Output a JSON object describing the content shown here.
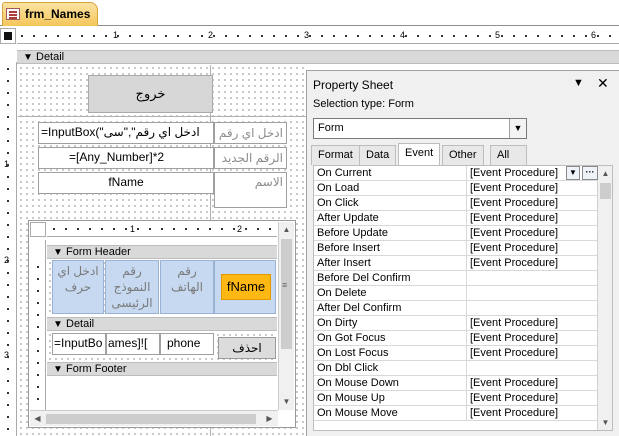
{
  "document_tab": {
    "label": "frm_Names",
    "icon": "form-icon"
  },
  "ruler": {
    "top_numbers": [
      "1",
      "2",
      "3",
      "4",
      "5",
      "6"
    ],
    "left_numbers": [
      "1",
      "2",
      "3"
    ]
  },
  "sections": {
    "detail": "Detail"
  },
  "main_form": {
    "exit_button": "خروج",
    "row1_text": "=InputBox(\"ادخل اي رقم\",\"سى",
    "row1_label": "ادخل اي رقم",
    "row2_text": "=[Any_Number]*2",
    "row2_label": "الرقم الجديد",
    "row3_text": "fName",
    "row3_label": "الاسم"
  },
  "subform": {
    "ruler_numbers": [
      "1",
      "2"
    ],
    "form_header": "Form Header",
    "detail": "Detail",
    "form_footer": "Form Footer",
    "headers": [
      "ادخل اي حرف",
      "رقم النموذج الرئيسى",
      "رقم الهاتف",
      "fName"
    ],
    "detail_fields": [
      "=InputBo",
      "ames]![",
      "phone"
    ],
    "delete_button": "احذف"
  },
  "property_sheet": {
    "title": "Property Sheet",
    "selection_type_label": "Selection type:",
    "selection_type_value": "Form",
    "object_combo": "Form",
    "tabs": [
      "Format",
      "Data",
      "Event",
      "Other",
      "All"
    ],
    "active_tab": "Event",
    "rows": [
      {
        "name": "On Current",
        "value": "[Event Procedure]"
      },
      {
        "name": "On Load",
        "value": "[Event Procedure]"
      },
      {
        "name": "On Click",
        "value": "[Event Procedure]"
      },
      {
        "name": "After Update",
        "value": "[Event Procedure]"
      },
      {
        "name": "Before Update",
        "value": "[Event Procedure]"
      },
      {
        "name": "Before Insert",
        "value": "[Event Procedure]"
      },
      {
        "name": "After Insert",
        "value": "[Event Procedure]"
      },
      {
        "name": "Before Del Confirm",
        "value": ""
      },
      {
        "name": "On Delete",
        "value": ""
      },
      {
        "name": "After Del Confirm",
        "value": ""
      },
      {
        "name": "On Dirty",
        "value": "[Event Procedure]"
      },
      {
        "name": "On Got Focus",
        "value": "[Event Procedure]"
      },
      {
        "name": "On Lost Focus",
        "value": "[Event Procedure]"
      },
      {
        "name": "On Dbl Click",
        "value": ""
      },
      {
        "name": "On Mouse Down",
        "value": "[Event Procedure]"
      },
      {
        "name": "On Mouse Up",
        "value": "[Event Procedure]"
      },
      {
        "name": "On Mouse Move",
        "value": "[Event Procedure]"
      }
    ]
  },
  "colors": {
    "tab_gold": "#f4c65a",
    "selected_control": "#fdb813",
    "header_cell": "#c6d9f1"
  }
}
